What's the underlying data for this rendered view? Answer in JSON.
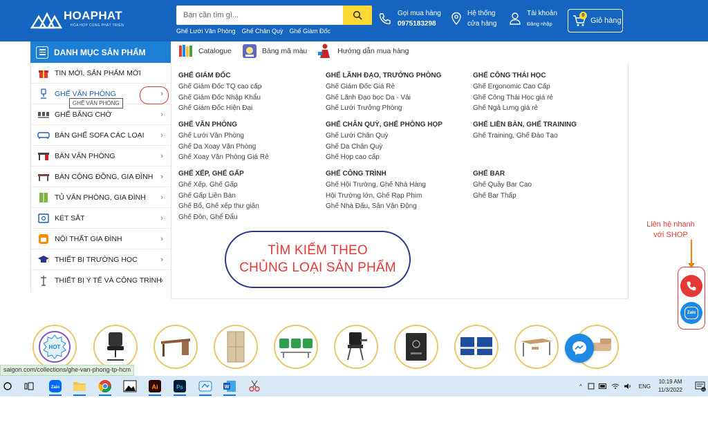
{
  "brand": {
    "name": "HOAPHAT",
    "tagline": "HÒA HỢP CÙNG PHÁT TRIỂN"
  },
  "search": {
    "placeholder": "Bạn cần tìm gì..."
  },
  "quick_links": [
    "Ghế Lưới Văn Phòng",
    "Ghế Chân Quỳ",
    "Ghế Giám Đốc"
  ],
  "header": {
    "hotline_label": "Gọi mua hàng",
    "hotline_number": "0975183298",
    "stores_line1": "Hệ thống",
    "stores_line2": "cửa hàng",
    "account_label": "Tài khoản",
    "account_sub": "Đăng nhập",
    "cart_count": "0",
    "cart_label": "Giỏ hàng"
  },
  "sidebar": {
    "title": "DANH MỤC SẢN PHẨM",
    "items": [
      {
        "label": "TIN MỚI, SẢN PHẨM MỚI",
        "icon": "gift-icon"
      },
      {
        "label": "GHẾ VĂN PHÒNG",
        "icon": "office-chair-icon"
      },
      {
        "label": "GHẾ BĂNG CHỜ",
        "icon": "waiting-bench-icon"
      },
      {
        "label": "BÀN GHẾ SOFA CÁC LOẠI",
        "icon": "sofa-icon"
      },
      {
        "label": "BÀN VĂN PHÒNG",
        "icon": "desk-icon"
      },
      {
        "label": "BÀN CỘNG ĐỒNG, GIA ĐÌNH",
        "icon": "table-icon"
      },
      {
        "label": "TỦ VĂN PHÒNG, GIA ĐÌNH",
        "icon": "cabinet-icon"
      },
      {
        "label": "KÉT SẮT",
        "icon": "safe-icon"
      },
      {
        "label": "NỘI THẤT GIA ĐÌNH",
        "icon": "home-furniture-icon"
      },
      {
        "label": "THIẾT BỊ TRƯỜNG HỌC",
        "icon": "graduation-cap-icon"
      },
      {
        "label": "THIẾT BỊ Y TẾ VÀ CÔNG TRÌNH",
        "icon": "medical-icon"
      }
    ],
    "tooltip": "GHẾ VĂN PHÒNG"
  },
  "subnav": [
    "Catalogue",
    "Bảng mã màu",
    "Hướng dẫn mua hàng"
  ],
  "mega_menu": {
    "groups": [
      {
        "title": "GHẾ GIÁM ĐỐC",
        "links": [
          "Ghế Giám Đốc TQ cao cấp",
          "Ghế Giám Đốc Nhập Khẩu",
          "Ghế Giám Đốc Hiện Đại"
        ]
      },
      {
        "title": "GHẾ VĂN PHÒNG",
        "links": [
          "Ghế Lưới Văn Phòng",
          "Ghế Da Xoay Văn Phòng",
          "Ghế Xoay Văn Phòng Giá Rẻ"
        ]
      },
      {
        "title": "GHẾ XẾP, GHẾ GẤP",
        "links": [
          "Ghế Xếp, Ghế Gấp",
          "Ghế Gấp Liền Bàn",
          "Ghế Bổ, Ghế xếp thư giãn",
          "Ghế Đôn, Ghế Đẩu"
        ]
      },
      {
        "title": "GHẾ LÃNH ĐẠO, TRƯỞNG PHÒNG",
        "links": [
          "Ghế Giám Đốc Giá Rẻ",
          "Ghế Lãnh Đạo bọc Da - Vải",
          "Ghế Lưới Trưởng Phòng"
        ]
      },
      {
        "title": "GHẾ CHÂN QUỲ, GHẾ PHÒNG HỌP",
        "links": [
          "Ghế Lưới Chân Quỳ",
          "Ghế Da Chân Quỳ",
          "Ghế Họp cao cấp"
        ]
      },
      {
        "title": "GHẾ CÔNG TRÌNH",
        "links": [
          "Ghế Hội Trường, Ghế Nhà Hàng",
          "Hội Trường lớn, Ghế Rạp Phim",
          "Ghế Nhà Đấu, Sân Vận Động"
        ]
      },
      {
        "title": "GHẾ CÔNG THÁI HỌC",
        "links": [
          "Ghế Ergonomic Cao Cấp",
          "Ghế Công Thái Học giá rẻ",
          "Ghế Ngả Lưng giá rẻ"
        ]
      },
      {
        "title": "GHẾ LIỀN BÀN, GHẾ TRAINING",
        "links": [
          "Ghế Training, Ghế Đào Tạo"
        ]
      },
      {
        "title": "GHẾ BAR",
        "links": [
          "Ghế Quầy Bar Cao",
          "Ghế Bar Thấp"
        ]
      }
    ],
    "cta_line1": "TÌM KIẾM THEO",
    "cta_line2": "CHỦNG LOẠI SẢN PHẨM"
  },
  "contact": {
    "line1": "Liên hệ nhanh",
    "line2": "với SHOP",
    "zalo_text": "Zalo"
  },
  "product_circles": [
    "hot-badge",
    "mesh-chair",
    "office-desk",
    "wood-cabinet",
    "green-bench",
    "training-chair",
    "safe-box",
    "partition",
    "school-desk",
    "sofa-set"
  ],
  "hot_badge": "HOT",
  "status_url": "saigon.com/collections/ghe-van-phong-tp-hcm",
  "taskbar": {
    "zalo_text": "Zalo",
    "lang": "ENG",
    "time": "10:19 AM",
    "date": "11/3/2022",
    "notif_count": "11"
  },
  "colors": {
    "brand_blue": "#1565c0",
    "accent_yellow": "#fdd835",
    "cta_red": "#e53935",
    "cta_border": "#2d3a8c"
  }
}
